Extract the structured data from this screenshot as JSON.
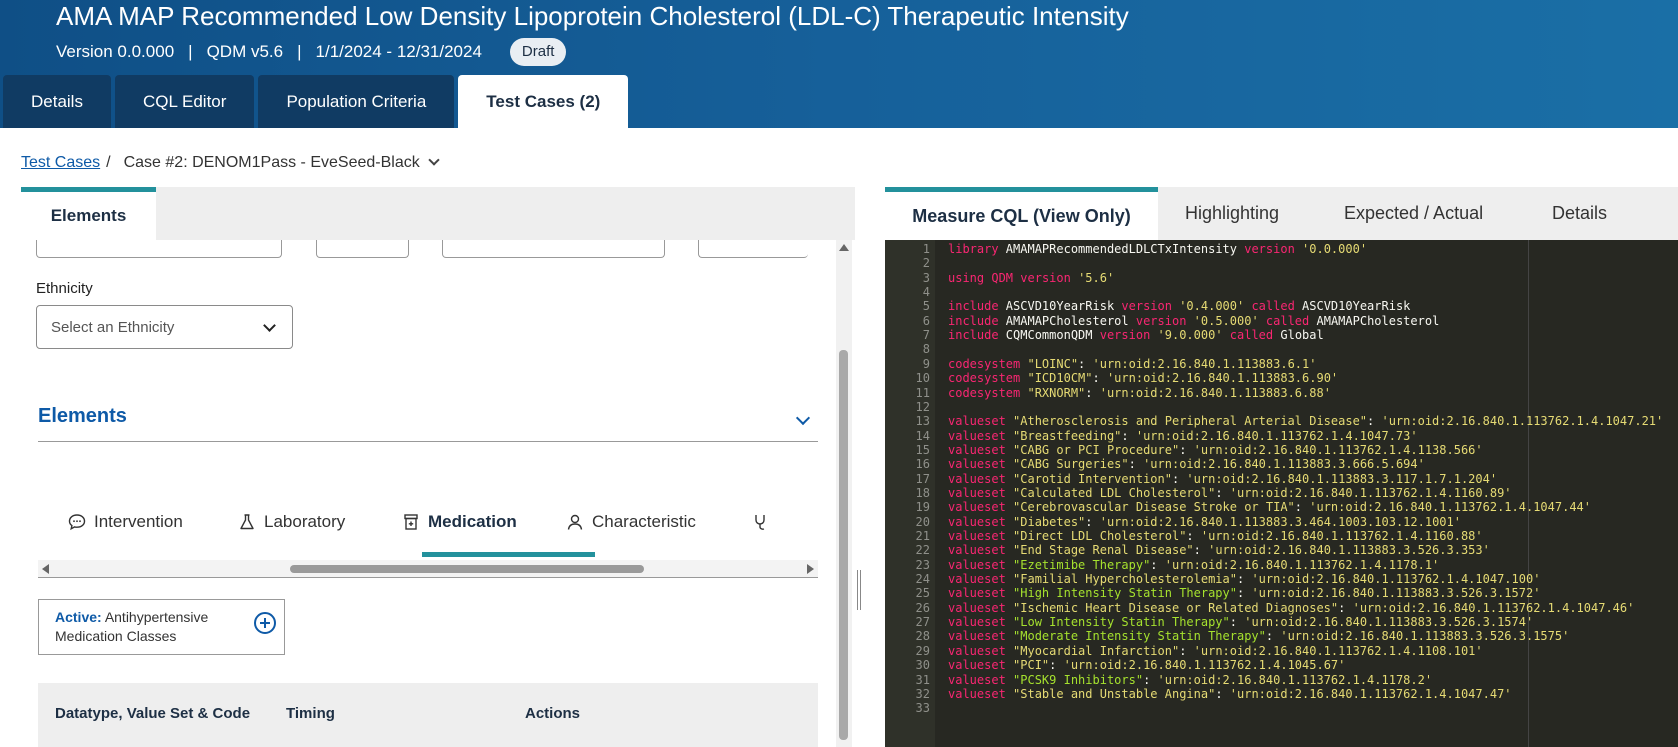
{
  "header": {
    "title": "AMA MAP Recommended Low Density Lipoprotein Cholesterol (LDL-C) Therapeutic Intensity",
    "version": "Version 0.0.000",
    "model": "QDM v5.6",
    "period": "1/1/2024 - 12/31/2024",
    "status": "Draft",
    "separator": "|"
  },
  "tabs": [
    "Details",
    "CQL Editor",
    "Population Criteria",
    "Test Cases (2)"
  ],
  "breadcrumb": {
    "link": "Test Cases",
    "slash": "/",
    "current": "Case #2: DENOM1Pass - EveSeed-Black"
  },
  "left": {
    "tab": "Elements",
    "ethnicity_label": "Ethnicity",
    "ethnicity_placeholder": "Select an Ethnicity",
    "elements_title": "Elements",
    "categories": [
      "Intervention",
      "Laboratory",
      "Medication",
      "Characteristic"
    ],
    "active_prefix": "Active:",
    "active_text": "Antihypertensive Medication Classes",
    "table_headers": [
      "Datatype, Value Set & Code",
      "Timing",
      "Actions"
    ]
  },
  "right": {
    "tabs": [
      "Measure CQL (View Only)",
      "Highlighting",
      "Expected / Actual",
      "Details"
    ]
  },
  "cql_lines": [
    [
      [
        "kw",
        "library"
      ],
      [
        "t",
        " AMAMAPRecommendedLDLCTxIntensity "
      ],
      [
        "kw",
        "version"
      ],
      [
        "str",
        " '0.0.000'"
      ]
    ],
    [],
    [
      [
        "kw",
        "using"
      ],
      [
        "t",
        " "
      ],
      [
        "kw",
        "QDM"
      ],
      [
        "t",
        " "
      ],
      [
        "kw",
        "version"
      ],
      [
        "str",
        " '5.6'"
      ]
    ],
    [],
    [
      [
        "kw",
        "include"
      ],
      [
        "t",
        " ASCVD10YearRisk "
      ],
      [
        "kw",
        "version"
      ],
      [
        "str",
        " '0.4.000'"
      ],
      [
        "kw",
        " called"
      ],
      [
        "t",
        " ASCVD10YearRisk"
      ]
    ],
    [
      [
        "kw",
        "include"
      ],
      [
        "t",
        " AMAMAPCholesterol "
      ],
      [
        "kw",
        "version"
      ],
      [
        "str",
        " '0.5.000'"
      ],
      [
        "kw",
        " called"
      ],
      [
        "t",
        " AMAMAPCholesterol"
      ]
    ],
    [
      [
        "kw",
        "include"
      ],
      [
        "t",
        " CQMCommonQDM "
      ],
      [
        "kw",
        "version"
      ],
      [
        "str",
        " '9.0.000'"
      ],
      [
        "kw",
        " called"
      ],
      [
        "t",
        " Global"
      ]
    ],
    [],
    [
      [
        "kw",
        "codesystem"
      ],
      [
        "str",
        " \"LOINC\""
      ],
      [
        "t",
        ": "
      ],
      [
        "str",
        "'urn:oid:2.16.840.1.113883.6.1'"
      ]
    ],
    [
      [
        "kw",
        "codesystem"
      ],
      [
        "str",
        " \"ICD10CM\""
      ],
      [
        "t",
        ": "
      ],
      [
        "str",
        "'urn:oid:2.16.840.1.113883.6.90'"
      ]
    ],
    [
      [
        "kw",
        "codesystem"
      ],
      [
        "str",
        " \"RXNORM\""
      ],
      [
        "t",
        ": "
      ],
      [
        "str",
        "'urn:oid:2.16.840.1.113883.6.88'"
      ]
    ],
    [],
    [
      [
        "kw",
        "valueset"
      ],
      [
        "str",
        " \"Atherosclerosis and Peripheral Arterial Disease\""
      ],
      [
        "t",
        ": "
      ],
      [
        "str",
        "'urn:oid:2.16.840.1.113762.1.4.1047.21'"
      ]
    ],
    [
      [
        "kw",
        "valueset"
      ],
      [
        "str",
        " \"Breastfeeding\""
      ],
      [
        "t",
        ": "
      ],
      [
        "str",
        "'urn:oid:2.16.840.1.113762.1.4.1047.73'"
      ]
    ],
    [
      [
        "kw",
        "valueset"
      ],
      [
        "str",
        " \"CABG or PCI Procedure\""
      ],
      [
        "t",
        ": "
      ],
      [
        "str",
        "'urn:oid:2.16.840.1.113762.1.4.1138.566'"
      ]
    ],
    [
      [
        "kw",
        "valueset"
      ],
      [
        "str",
        " \"CABG Surgeries\""
      ],
      [
        "t",
        ": "
      ],
      [
        "str",
        "'urn:oid:2.16.840.1.113883.3.666.5.694'"
      ]
    ],
    [
      [
        "kw",
        "valueset"
      ],
      [
        "str",
        " \"Carotid Intervention\""
      ],
      [
        "t",
        ": "
      ],
      [
        "str",
        "'urn:oid:2.16.840.1.113883.3.117.1.7.1.204'"
      ]
    ],
    [
      [
        "kw",
        "valueset"
      ],
      [
        "str",
        " \"Calculated LDL Cholesterol\""
      ],
      [
        "t",
        ": "
      ],
      [
        "str",
        "'urn:oid:2.16.840.1.113762.1.4.1160.89'"
      ]
    ],
    [
      [
        "kw",
        "valueset"
      ],
      [
        "str",
        " \"Cerebrovascular Disease Stroke or TIA\""
      ],
      [
        "t",
        ": "
      ],
      [
        "str",
        "'urn:oid:2.16.840.1.113762.1.4.1047.44'"
      ]
    ],
    [
      [
        "kw",
        "valueset"
      ],
      [
        "str",
        " \"Diabetes\""
      ],
      [
        "t",
        ": "
      ],
      [
        "str",
        "'urn:oid:2.16.840.1.113883.3.464.1003.103.12.1001'"
      ]
    ],
    [
      [
        "kw",
        "valueset"
      ],
      [
        "str",
        " \"Direct LDL Cholesterol\""
      ],
      [
        "t",
        ": "
      ],
      [
        "str",
        "'urn:oid:2.16.840.1.113762.1.4.1160.88'"
      ]
    ],
    [
      [
        "kw",
        "valueset"
      ],
      [
        "str",
        " \"End Stage Renal Disease\""
      ],
      [
        "t",
        ": "
      ],
      [
        "str",
        "'urn:oid:2.16.840.1.113883.3.526.3.353'"
      ]
    ],
    [
      [
        "kw",
        "valueset"
      ],
      [
        "grn",
        " \"Ezetimibe Therapy\""
      ],
      [
        "t",
        ": "
      ],
      [
        "str",
        "'urn:oid:2.16.840.1.113762.1.4.1178.1'"
      ]
    ],
    [
      [
        "kw",
        "valueset"
      ],
      [
        "str",
        " \"Familial Hypercholesterolemia\""
      ],
      [
        "t",
        ": "
      ],
      [
        "str",
        "'urn:oid:2.16.840.1.113762.1.4.1047.100'"
      ]
    ],
    [
      [
        "kw",
        "valueset"
      ],
      [
        "grn",
        " \"High Intensity Statin Therapy\""
      ],
      [
        "t",
        ": "
      ],
      [
        "str",
        "'urn:oid:2.16.840.1.113883.3.526.3.1572'"
      ]
    ],
    [
      [
        "kw",
        "valueset"
      ],
      [
        "str",
        " \"Ischemic Heart Disease or Related Diagnoses\""
      ],
      [
        "t",
        ": "
      ],
      [
        "str",
        "'urn:oid:2.16.840.1.113762.1.4.1047.46'"
      ]
    ],
    [
      [
        "kw",
        "valueset"
      ],
      [
        "grn",
        " \"Low Intensity Statin Therapy\""
      ],
      [
        "t",
        ": "
      ],
      [
        "str",
        "'urn:oid:2.16.840.1.113883.3.526.3.1574'"
      ]
    ],
    [
      [
        "kw",
        "valueset"
      ],
      [
        "grn",
        " \"Moderate Intensity Statin Therapy\""
      ],
      [
        "t",
        ": "
      ],
      [
        "str",
        "'urn:oid:2.16.840.1.113883.3.526.3.1575'"
      ]
    ],
    [
      [
        "kw",
        "valueset"
      ],
      [
        "str",
        " \"Myocardial Infarction\""
      ],
      [
        "t",
        ": "
      ],
      [
        "str",
        "'urn:oid:2.16.840.1.113762.1.4.1108.101'"
      ]
    ],
    [
      [
        "kw",
        "valueset"
      ],
      [
        "str",
        " \"PCI\""
      ],
      [
        "t",
        ": "
      ],
      [
        "str",
        "'urn:oid:2.16.840.1.113762.1.4.1045.67'"
      ]
    ],
    [
      [
        "kw",
        "valueset"
      ],
      [
        "grn",
        " \"PCSK9 Inhibitors\""
      ],
      [
        "t",
        ": "
      ],
      [
        "str",
        "'urn:oid:2.16.840.1.113762.1.4.1178.2'"
      ]
    ],
    [
      [
        "kw",
        "valueset"
      ],
      [
        "str",
        " \"Stable and Unstable Angina\""
      ],
      [
        "t",
        ": "
      ],
      [
        "str",
        "'urn:oid:2.16.840.1.113762.1.4.1047.47'"
      ]
    ],
    []
  ],
  "colors": {
    "header": "#16609a",
    "accent": "#23919c",
    "link": "#0e5aa7",
    "editor_bg": "#272822"
  }
}
